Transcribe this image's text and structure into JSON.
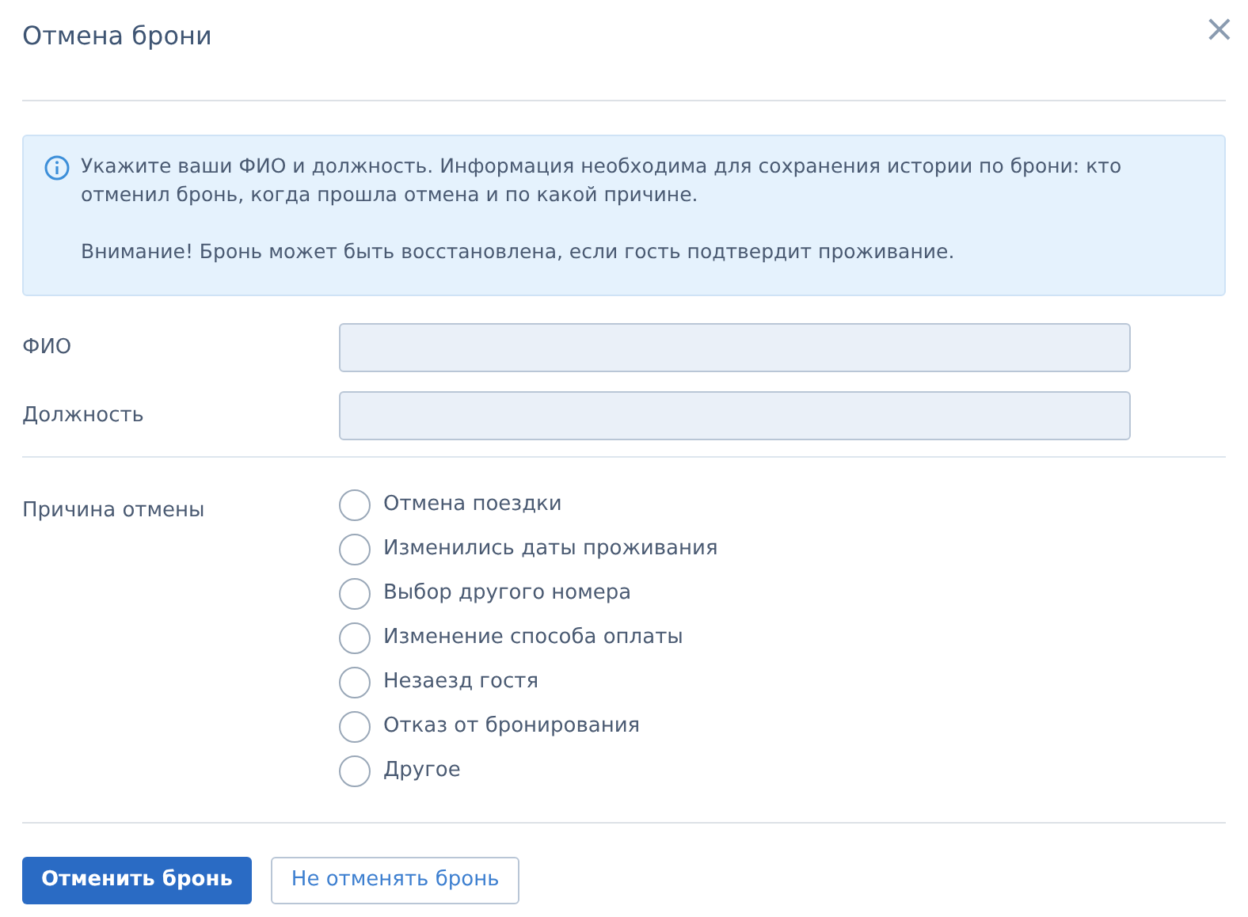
{
  "dialog": {
    "title": "Отмена брони",
    "close": "×"
  },
  "info": {
    "paragraphs": [
      "Укажите ваши ФИО и должность. Информация необходима для сохранения истории по брони: кто отменил бронь, когда прошла отмена и по какой причине.",
      "Внимание! Бронь может быть восстановлена, если гость подтвердит проживание."
    ]
  },
  "fields": [
    {
      "label": "ФИО"
    },
    {
      "label": "Должность"
    }
  ],
  "reason": {
    "label": "Причина отмены",
    "options": [
      {
        "label": "Отмена поездки",
        "selected": false
      },
      {
        "label": "Изменились даты проживания",
        "selected": false
      },
      {
        "label": "Выбор другого номера",
        "selected": false
      },
      {
        "label": "Изменение способа оплаты",
        "selected": false
      },
      {
        "label": "Незаезд гостя",
        "selected": false
      },
      {
        "label": "Отказ от бронирования",
        "selected": false
      },
      {
        "label": "Другое",
        "selected": false
      }
    ]
  },
  "buttons": [
    {
      "label": "Отменить бронь",
      "kind": "primary"
    },
    {
      "label": "Не отменять бронь",
      "kind": "secondary"
    }
  ]
}
